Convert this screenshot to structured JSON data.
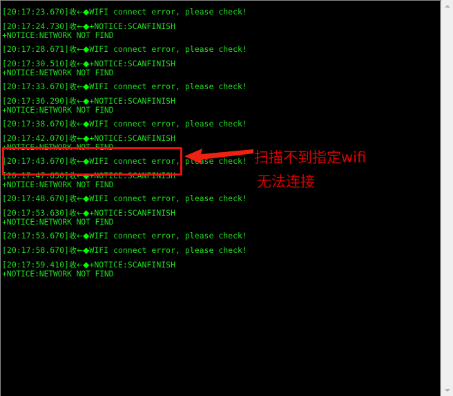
{
  "window": {
    "background_color": "#000000",
    "text_color": "#22dd22",
    "annotation_color": "#dd0000"
  },
  "console": {
    "recv_marker": "收",
    "direction_arrow": "←",
    "bullet": "◆",
    "blocks": [
      {
        "timestamp": "[20:17:23.670]",
        "message": "WIFI connect error, please check!",
        "sub": null,
        "highlighted": false
      },
      {
        "timestamp": "[20:17:24.730]",
        "message": "+NOTICE:SCANFINISH",
        "sub": "+NOTICE:NETWORK NOT FIND",
        "highlighted": false
      },
      {
        "timestamp": "[20:17:28.671]",
        "message": "WIFI connect error, please check!",
        "sub": null,
        "highlighted": false
      },
      {
        "timestamp": "[20:17:30.510]",
        "message": "+NOTICE:SCANFINISH",
        "sub": "+NOTICE:NETWORK NOT FIND",
        "highlighted": false
      },
      {
        "timestamp": "[20:17:33.670]",
        "message": "WIFI connect error, please check!",
        "sub": null,
        "highlighted": false
      },
      {
        "timestamp": "[20:17:36.290]",
        "message": "+NOTICE:SCANFINISH",
        "sub": "+NOTICE:NETWORK NOT FIND",
        "highlighted": false
      },
      {
        "timestamp": "[20:17:38.670]",
        "message": "WIFI connect error, please check!",
        "sub": null,
        "highlighted": false
      },
      {
        "timestamp": "[20:17:42.070]",
        "message": "+NOTICE:SCANFINISH",
        "sub": "+NOTICE:NETWORK NOT FIND",
        "highlighted": true
      },
      {
        "timestamp": "[20:17:43.670]",
        "message": "WIFI connect error, please check!",
        "sub": null,
        "highlighted": false
      },
      {
        "timestamp": "[20:17:47.850]",
        "message": "+NOTICE:SCANFINISH",
        "sub": "+NOTICE:NETWORK NOT FIND",
        "highlighted": false
      },
      {
        "timestamp": "[20:17:48.670]",
        "message": "WIFI connect error, please check!",
        "sub": null,
        "highlighted": false
      },
      {
        "timestamp": "[20:17:53.630]",
        "message": "+NOTICE:SCANFINISH",
        "sub": "+NOTICE:NETWORK NOT FIND",
        "highlighted": false
      },
      {
        "timestamp": "[20:17:53.670]",
        "message": "WIFI connect error, please check!",
        "sub": null,
        "highlighted": false
      },
      {
        "timestamp": "[20:17:58.670]",
        "message": "WIFI connect error, please check!",
        "sub": null,
        "highlighted": false
      },
      {
        "timestamp": "[20:17:59.410]",
        "message": "+NOTICE:SCANFINISH",
        "sub": "+NOTICE:NETWORK NOT FIND",
        "highlighted": false
      }
    ]
  },
  "annotations": {
    "note_line_1": "扫描不到指定wifi",
    "note_line_2": "无法连接",
    "arrow_name": "left-pointing-arrow",
    "box_name": "highlight-rectangle"
  },
  "scrollbar": {
    "up_arrow": "scroll-up",
    "down_arrow": "scroll-down"
  }
}
